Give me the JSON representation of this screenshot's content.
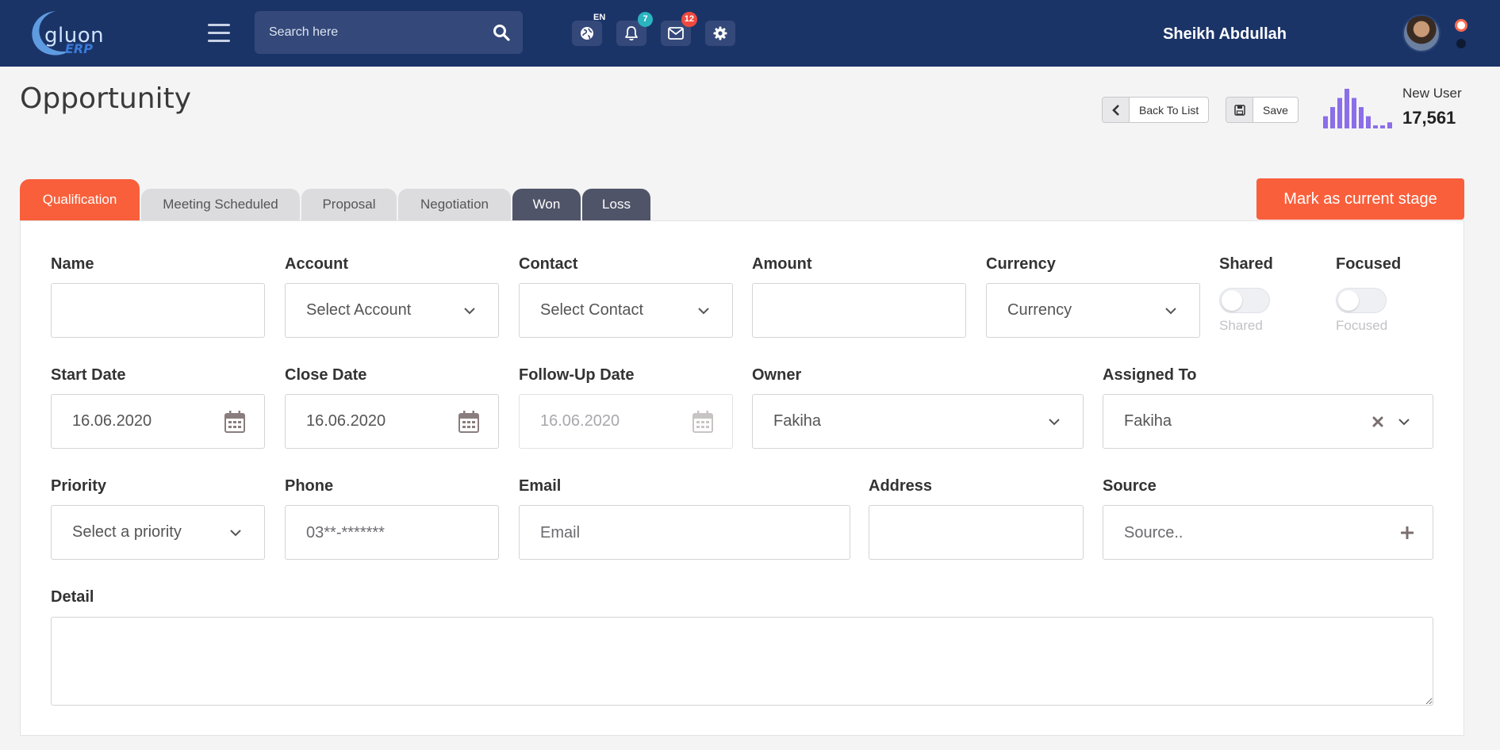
{
  "topbar": {
    "logo_text": "gluon",
    "logo_sub": "ERP",
    "search_placeholder": "Search here",
    "language_badge": "EN",
    "notifications_count": "7",
    "messages_count": "12",
    "username": "Sheikh Abdullah",
    "colors": {
      "background": "#1b3468",
      "notif_badge": "#2bb3c0",
      "msg_badge": "#f04a3e"
    }
  },
  "header": {
    "title": "Opportunity",
    "back_label": "Back To List",
    "save_label": "Save",
    "stat_label": "New User",
    "stat_value": "17,561",
    "sparkline_values": [
      4,
      7,
      10,
      13,
      10,
      7,
      4,
      1,
      1,
      2
    ]
  },
  "tabs": [
    {
      "label": "Qualification",
      "state": "active"
    },
    {
      "label": "Meeting Scheduled",
      "state": "light"
    },
    {
      "label": "Proposal",
      "state": "light"
    },
    {
      "label": "Negotiation",
      "state": "light"
    },
    {
      "label": "Won",
      "state": "dark"
    },
    {
      "label": "Loss",
      "state": "dark"
    }
  ],
  "stage_button": "Mark as current stage",
  "form": {
    "name": {
      "label": "Name",
      "value": ""
    },
    "account": {
      "label": "Account",
      "placeholder": "Select Account"
    },
    "contact": {
      "label": "Contact",
      "placeholder": "Select Contact"
    },
    "amount": {
      "label": "Amount",
      "value": ""
    },
    "currency": {
      "label": "Currency",
      "placeholder": "Currency"
    },
    "shared": {
      "label": "Shared",
      "toggle_label": "Shared",
      "on": false
    },
    "focused": {
      "label": "Focused",
      "toggle_label": "Focused",
      "on": false
    },
    "start_date": {
      "label": "Start Date",
      "value": "16.06.2020"
    },
    "close_date": {
      "label": "Close Date",
      "value": "16.06.2020"
    },
    "followup_date": {
      "label": "Follow-Up Date",
      "value": "16.06.2020"
    },
    "owner": {
      "label": "Owner",
      "value": "Fakiha"
    },
    "assigned_to": {
      "label": "Assigned To",
      "value": "Fakiha"
    },
    "priority": {
      "label": "Priority",
      "placeholder": "Select a priority"
    },
    "phone": {
      "label": "Phone",
      "placeholder": "03**-*******"
    },
    "email": {
      "label": "Email",
      "placeholder": "Email"
    },
    "address": {
      "label": "Address",
      "value": ""
    },
    "source": {
      "label": "Source",
      "placeholder": "Source.."
    },
    "detail": {
      "label": "Detail",
      "value": ""
    }
  },
  "accent_color": "#f95f3b"
}
